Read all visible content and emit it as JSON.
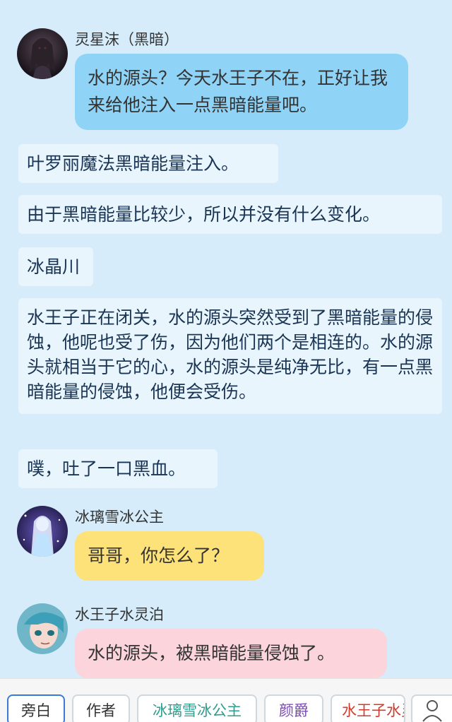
{
  "messages": {
    "m1": {
      "speaker": "灵星沫（黑暗）",
      "text": "水的源头？今天水王子不在，正好让我来给他注入一点黑暗能量吧。",
      "color": "#8fd3f6"
    },
    "n1": "叶罗丽魔法黑暗能量注入。",
    "n2": "由于黑暗能量比较少，所以并没有什么变化。",
    "n3": "冰晶川",
    "n4": "水王子正在闭关，水的源头突然受到了黑暗能量的侵蚀，他呢也受了伤，因为他们两个是相连的。水的源头就相当于它的心，水的源头是纯净无比，有一点黑暗能量的侵蚀，他便会受伤。",
    "n5": "噗，吐了一口黑血。",
    "m2": {
      "speaker": "冰璃雪冰公主",
      "text": "哥哥，你怎么了？",
      "color": "#fde27a"
    },
    "m3": {
      "speaker": "水王子水灵泊",
      "text": "水的源头，被黑暗能量侵蚀了。",
      "color": "#fbd4dc"
    }
  },
  "toolbar": {
    "tabs": [
      {
        "label": "旁白",
        "color": "#333333"
      },
      {
        "label": "作者",
        "color": "#333333"
      },
      {
        "label": "冰璃雪冰公主",
        "color": "#2e9e8f"
      },
      {
        "label": "颜爵",
        "color": "#7b4bb5"
      },
      {
        "label": "水王子水灵泊",
        "color": "#d23a2a"
      }
    ],
    "user_icon": "user-icon"
  }
}
